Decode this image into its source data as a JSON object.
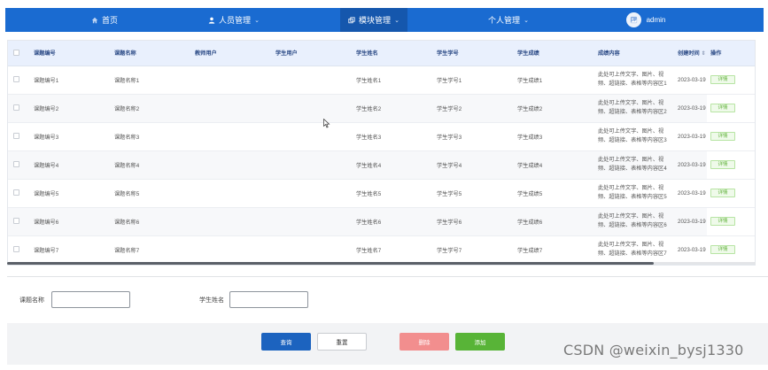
{
  "nav": {
    "items": [
      {
        "label": "首页",
        "icon": "home-icon"
      },
      {
        "label": "人员管理",
        "icon": "person-icon"
      },
      {
        "label": "模块管理",
        "icon": "module-icon"
      },
      {
        "label": "个人管理",
        "icon": ""
      }
    ],
    "user": "admin"
  },
  "table": {
    "columns": [
      "课题编号",
      "课题名称",
      "教师用户",
      "学生用户",
      "学生姓名",
      "学生学号",
      "学生成绩",
      "成绩内容",
      "创建时间",
      "操作"
    ],
    "rows": [
      [
        "课题编号1",
        "课题名称1",
        "",
        "",
        "学生姓名1",
        "学生学号1",
        "学生成绩1",
        "此处可上传文字、图片、视频、超链接、表格等内容区1",
        "2023-03-19 1"
      ],
      [
        "课题编号2",
        "课题名称2",
        "",
        "",
        "学生姓名2",
        "学生学号2",
        "学生成绩2",
        "此处可上传文字、图片、视频、超链接、表格等内容区2",
        "2023-03-19 1"
      ],
      [
        "课题编号3",
        "课题名称3",
        "",
        "",
        "学生姓名3",
        "学生学号3",
        "学生成绩3",
        "此处可上传文字、图片、视频、超链接、表格等内容区3",
        "2023-03-19 1"
      ],
      [
        "课题编号4",
        "课题名称4",
        "",
        "",
        "学生姓名4",
        "学生学号4",
        "学生成绩4",
        "此处可上传文字、图片、视频、超链接、表格等内容区4",
        "2023-03-19 1"
      ],
      [
        "课题编号5",
        "课题名称5",
        "",
        "",
        "学生姓名5",
        "学生学号5",
        "学生成绩5",
        "此处可上传文字、图片、视频、超链接、表格等内容区5",
        "2023-03-19 1"
      ],
      [
        "课题编号6",
        "课题名称6",
        "",
        "",
        "学生姓名6",
        "学生学号6",
        "学生成绩6",
        "此处可上传文字、图片、视频、超链接、表格等内容区6",
        "2023-03-19 1"
      ],
      [
        "课题编号7",
        "课题名称7",
        "",
        "",
        "学生姓名7",
        "学生学号7",
        "学生成绩7",
        "此处可上传文字、图片、视频、超链接、表格等内容区7",
        "2023-03-19 1"
      ]
    ],
    "detail_label": "详情"
  },
  "search": {
    "label_topic": "课题名称",
    "value_topic": "",
    "label_student": "学生姓名",
    "value_student": "",
    "query": "查询",
    "reset": "重置",
    "delete": "删除",
    "add": "添加"
  },
  "watermark": "CSDN @weixin_bysj1330"
}
